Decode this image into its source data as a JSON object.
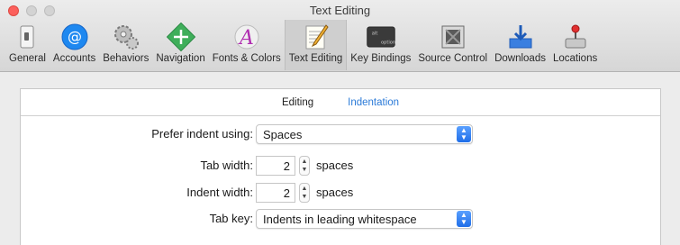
{
  "window": {
    "title": "Text Editing"
  },
  "toolbar": {
    "items": [
      {
        "label": "General",
        "icon": "general-switch-icon"
      },
      {
        "label": "Accounts",
        "icon": "at-sign-icon"
      },
      {
        "label": "Behaviors",
        "icon": "gears-icon"
      },
      {
        "label": "Navigation",
        "icon": "navigation-arrows-icon"
      },
      {
        "label": "Fonts & Colors",
        "icon": "font-a-icon"
      },
      {
        "label": "Text Editing",
        "icon": "pencil-paper-icon"
      },
      {
        "label": "Key Bindings",
        "icon": "option-key-icon"
      },
      {
        "label": "Source Control",
        "icon": "source-control-icon"
      },
      {
        "label": "Downloads",
        "icon": "downloads-tray-icon"
      },
      {
        "label": "Locations",
        "icon": "joystick-drive-icon"
      }
    ],
    "selected_index": 5
  },
  "tabs": {
    "editing": "Editing",
    "indentation": "Indentation",
    "active": "Indentation"
  },
  "form": {
    "prefer_indent": {
      "label": "Prefer indent using:",
      "value": "Spaces"
    },
    "tab_width": {
      "label": "Tab width:",
      "value": "2",
      "unit": "spaces"
    },
    "indent_width": {
      "label": "Indent width:",
      "value": "2",
      "unit": "spaces"
    },
    "tab_key": {
      "label": "Tab key:",
      "value": "Indents in leading whitespace"
    }
  },
  "colors": {
    "accent": "#2a7ad8",
    "close": "#fc605c"
  }
}
